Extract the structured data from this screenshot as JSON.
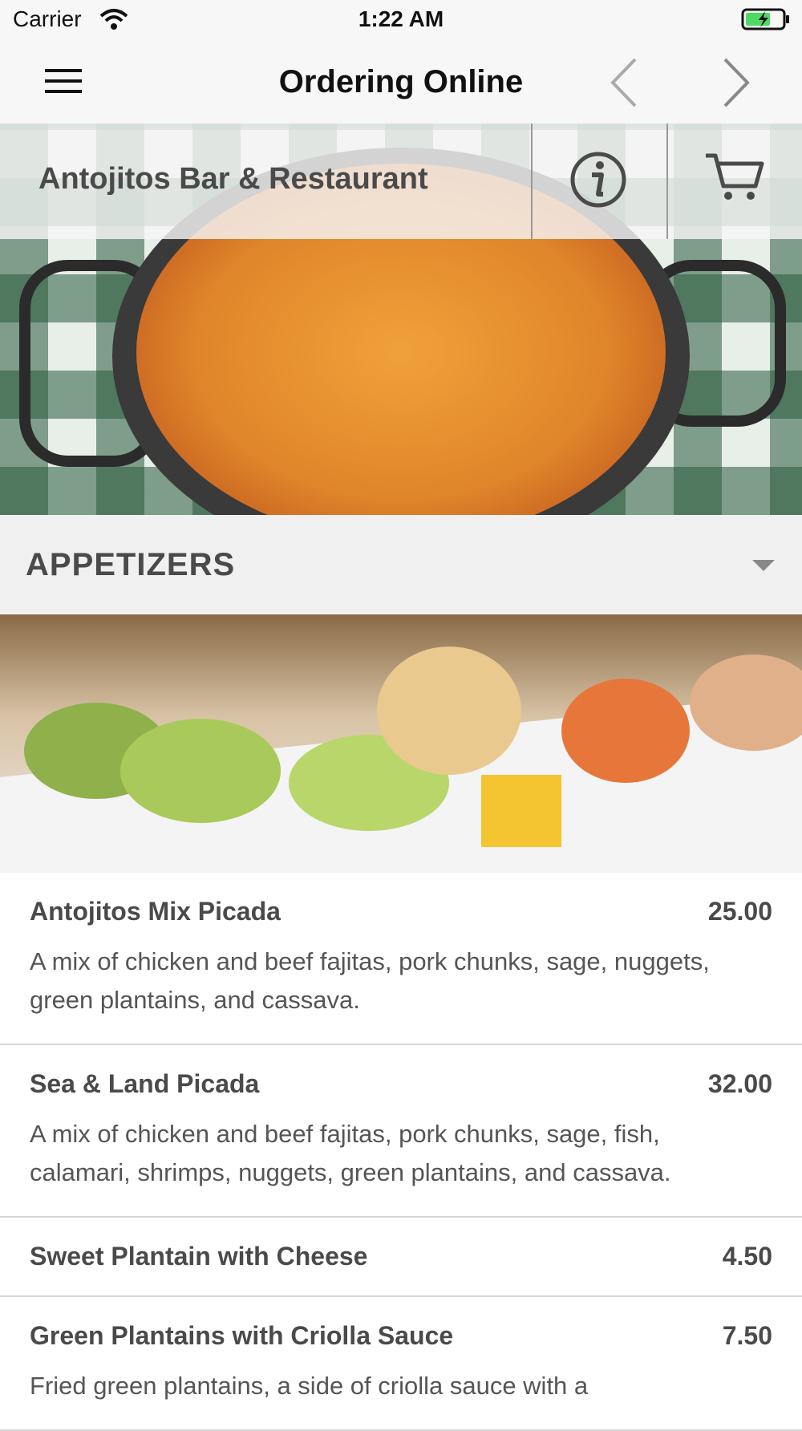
{
  "status_bar": {
    "carrier": "Carrier",
    "time": "1:22 AM"
  },
  "nav": {
    "title": "Ordering Online",
    "icons": [
      "menu-icon",
      "back-chevron-icon",
      "forward-chevron-icon"
    ]
  },
  "restaurant": {
    "name": "Antojitos Bar & Restaurant",
    "icons": [
      "info-icon",
      "cart-icon"
    ]
  },
  "category": {
    "label": "APPETIZERS"
  },
  "items": [
    {
      "name": "Antojitos Mix Picada",
      "price": "25.00",
      "description": "A mix of chicken and beef fajitas, pork chunks, sage, nuggets, green plantains, and cassava."
    },
    {
      "name": "Sea & Land Picada",
      "price": "32.00",
      "description": "A mix of chicken and beef fajitas, pork chunks, sage, fish, calamari, shrimps, nuggets, green plantains, and cassava."
    },
    {
      "name": "Sweet Plantain with Cheese",
      "price": "4.50",
      "description": ""
    },
    {
      "name": "Green Plantains with Criolla Sauce",
      "price": "7.50",
      "description": "Fried green plantains, a side of criolla sauce with a"
    }
  ]
}
